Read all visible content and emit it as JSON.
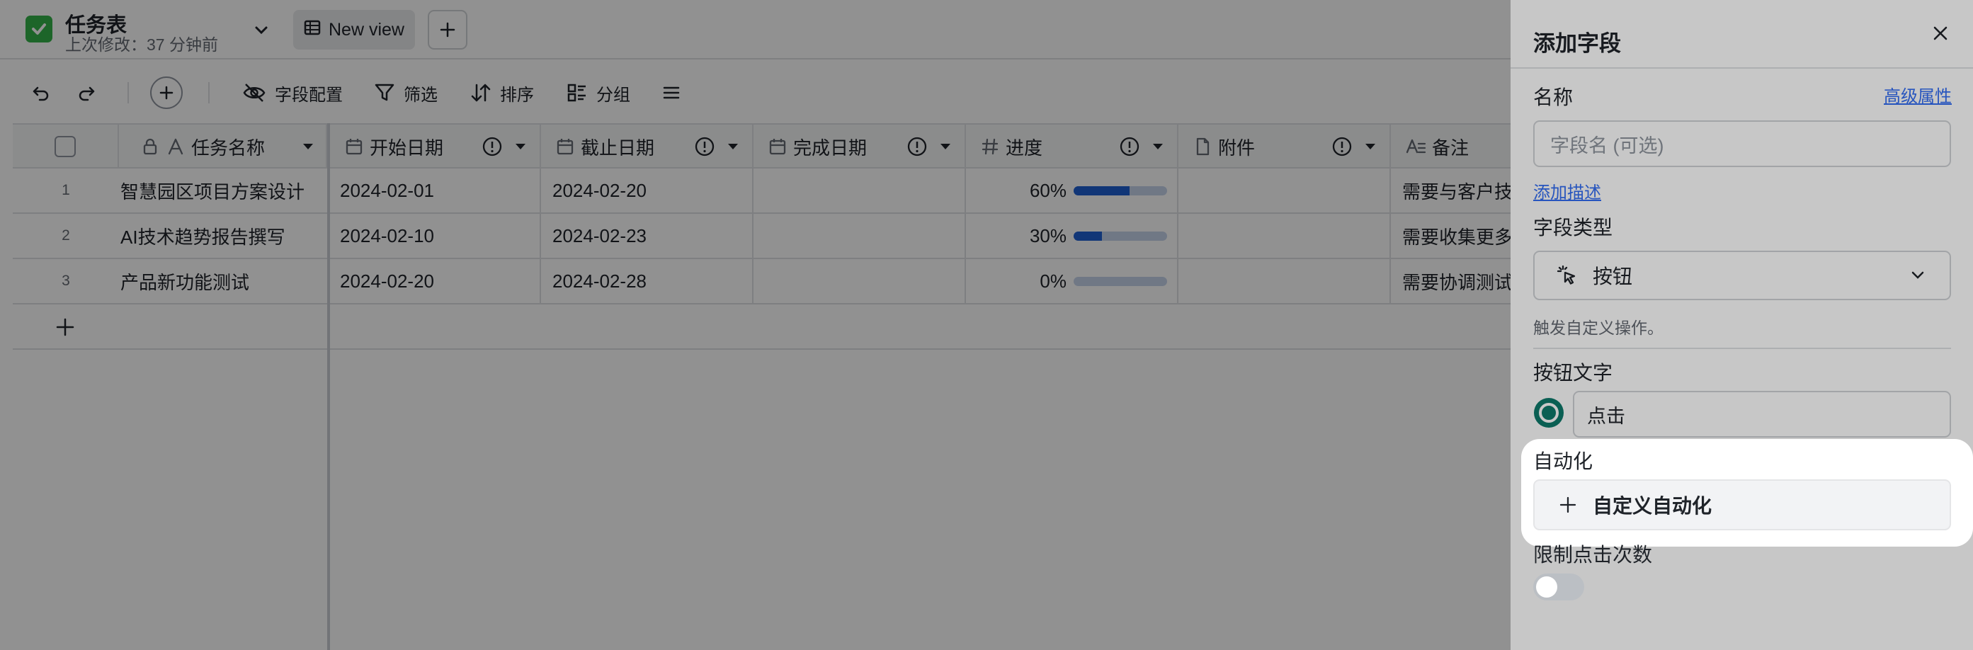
{
  "app": {
    "icon": "checkmark-square-icon",
    "title": "任务表",
    "last_modified": "上次修改：37 分钟前"
  },
  "views": {
    "current_label": "New view"
  },
  "toolbar": {
    "field_config": "字段配置",
    "filter": "筛选",
    "sort": "排序",
    "group": "分组"
  },
  "table": {
    "columns": [
      {
        "label": "任务名称",
        "icon": "text-icon"
      },
      {
        "label": "开始日期",
        "icon": "calendar-icon"
      },
      {
        "label": "截止日期",
        "icon": "calendar-icon"
      },
      {
        "label": "完成日期",
        "icon": "calendar-icon"
      },
      {
        "label": "进度",
        "icon": "number-icon"
      },
      {
        "label": "附件",
        "icon": "file-icon"
      },
      {
        "label": "备注",
        "icon": "text-icon"
      }
    ],
    "rows": [
      {
        "num": "1",
        "name": "智慧园区项目方案设计",
        "start": "2024-02-01",
        "due": "2024-02-20",
        "done": "",
        "progress_text": "60%",
        "progress": 0.6,
        "attachment": "",
        "note": "需要与客户技"
      },
      {
        "num": "2",
        "name": "AI技术趋势报告撰写",
        "start": "2024-02-10",
        "due": "2024-02-23",
        "done": "",
        "progress_text": "30%",
        "progress": 0.3,
        "attachment": "",
        "note": "需要收集更多"
      },
      {
        "num": "3",
        "name": "产品新功能测试",
        "start": "2024-02-20",
        "due": "2024-02-28",
        "done": "",
        "progress_text": "0%",
        "progress": 0.0,
        "attachment": "",
        "note": "需要协调测试"
      }
    ]
  },
  "panel": {
    "title": "添加字段",
    "name_label": "名称",
    "advanced_link": "高级属性",
    "name_placeholder": "字段名 (可选)",
    "add_description": "添加描述",
    "field_type_label": "字段类型",
    "field_type_value": "按钮",
    "field_type_help": "触发自定义操作。",
    "button_text_label": "按钮文字",
    "button_text_value": "点击",
    "button_color": "#0e7a6b",
    "automation_label": "自动化",
    "custom_automation": "自定义自动化",
    "limit_clicks_label": "限制点击次数",
    "limit_clicks_on": false
  }
}
